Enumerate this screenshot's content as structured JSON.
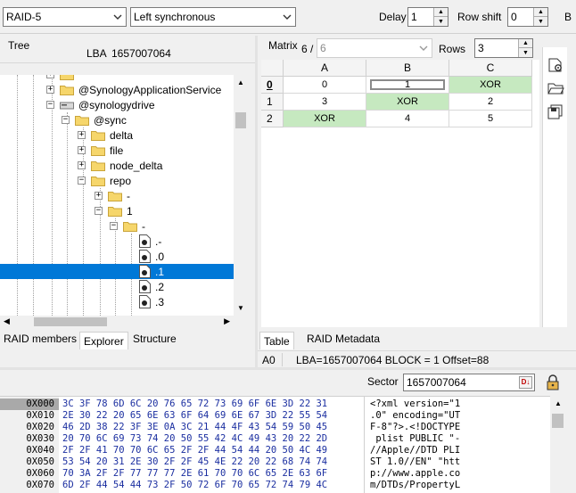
{
  "toolbar": {
    "raid_type": "RAID-5",
    "layout": "Left synchronous",
    "delay_label": "Delay",
    "delay_value": "1",
    "row_shift_label": "Row shift",
    "row_shift_value": "0",
    "trailing_label": "B"
  },
  "tree_panel": {
    "title": "Tree",
    "lba_label": "LBA",
    "lba_value": "1657007064",
    "items": [
      {
        "label": "@SynologyApplicationService"
      },
      {
        "label": "@synologydrive"
      },
      {
        "label": "@sync"
      },
      {
        "label": "delta"
      },
      {
        "label": "file"
      },
      {
        "label": "node_delta"
      },
      {
        "label": "repo"
      },
      {
        "label": "-"
      },
      {
        "label": "1"
      },
      {
        "label": "-"
      },
      {
        "label": ".-"
      },
      {
        "label": ".0"
      },
      {
        "label": ".1"
      },
      {
        "label": ".2"
      },
      {
        "label": ".3"
      }
    ],
    "tabs": [
      "RAID members",
      "Explorer",
      "Structure"
    ]
  },
  "matrix_panel": {
    "matrix_label": "Matrix",
    "matrix_prefix": "6 /",
    "matrix_value": "6",
    "rows_label": "Rows",
    "rows_value": "3",
    "columns": [
      "A",
      "B",
      "C"
    ],
    "row_labels": [
      "0",
      "1",
      "2"
    ],
    "cells": [
      [
        "0",
        "1",
        "XOR"
      ],
      [
        "3",
        "XOR",
        "2"
      ],
      [
        "XOR",
        "4",
        "5"
      ]
    ],
    "highlight_color": "#c6e9c0",
    "tabs": [
      "Table",
      "RAID Metadata"
    ],
    "status_cell": "A0",
    "status_text": "LBA=1657007064 BLOCK = 1 Offset=88"
  },
  "sector_bar": {
    "label": "Sector",
    "value": "1657007064"
  },
  "hex": {
    "addresses": [
      "0X000",
      "0X010",
      "0X020",
      "0X030",
      "0X040",
      "0X050",
      "0X060",
      "0X070"
    ],
    "bytes": [
      "3C 3F 78 6D 6C 20 76 65 72 73 69 6F 6E 3D 22 31",
      "2E 30 22 20 65 6E 63 6F 64 69 6E 67 3D 22 55 54",
      "46 2D 38 22 3F 3E 0A 3C 21 44 4F 43 54 59 50 45",
      "20 70 6C 69 73 74 20 50 55 42 4C 49 43 20 22 2D",
      "2F 2F 41 70 70 6C 65 2F 2F 44 54 44 20 50 4C 49",
      "53 54 20 31 2E 30 2F 2F 45 4E 22 20 22 68 74 74",
      "70 3A 2F 2F 77 77 77 2E 61 70 70 6C 65 2E 63 6F",
      "6D 2F 44 54 44 73 2F 50 72 6F 70 65 72 74 79 4C"
    ],
    "ascii": [
      "<?xml version=\"1",
      ".0\" encoding=\"UT",
      "F-8\"?>.<!DOCTYPE",
      " plist PUBLIC \"-",
      "//Apple//DTD PLI",
      "ST 1.0//EN\" \"htt",
      "p://www.apple.co",
      "m/DTDs/PropertyL"
    ]
  }
}
